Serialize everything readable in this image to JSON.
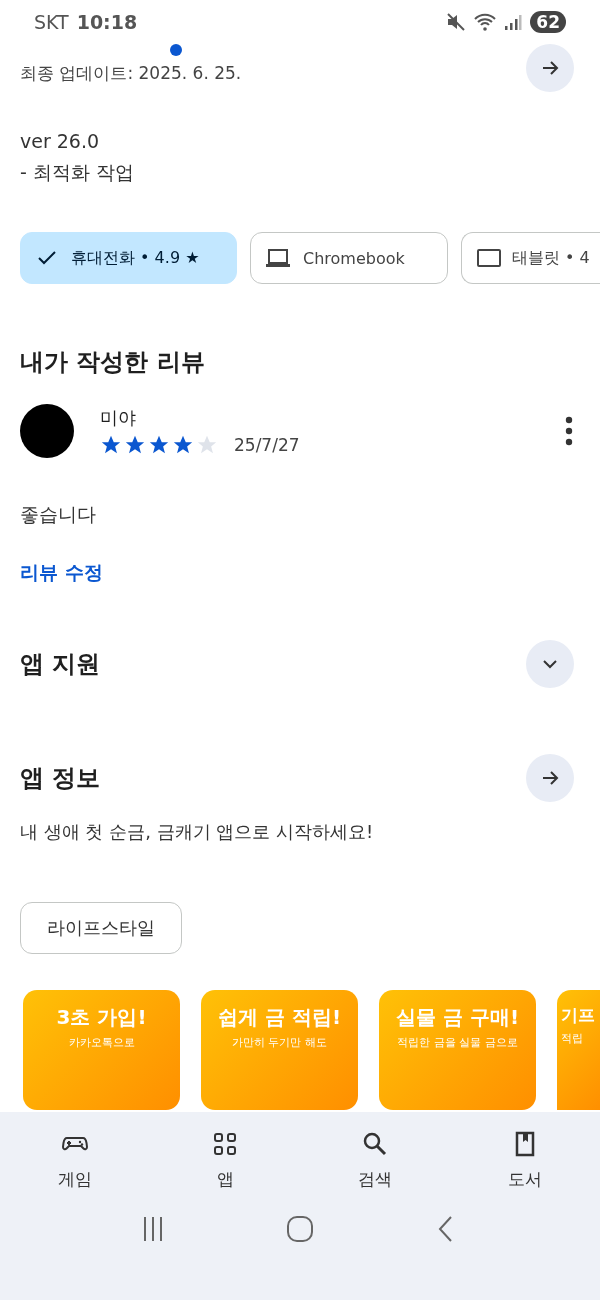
{
  "status_bar": {
    "carrier": "SKT",
    "time": "10:18",
    "battery": "62"
  },
  "whats_new": {
    "updated": "최종 업데이트: 2025. 6. 25.",
    "lines": [
      "ver 26.0",
      "- 최적화 작업"
    ]
  },
  "devices": [
    {
      "kind": "phone",
      "label": "휴대전화 • 4.9 ★",
      "selected": true
    },
    {
      "kind": "laptop",
      "label": "Chromebook",
      "selected": false
    },
    {
      "kind": "tablet",
      "label": "태블릿 • 4",
      "selected": false
    }
  ],
  "my_review": {
    "title": "내가 작성한 리뷰",
    "author": "미야",
    "stars": 4,
    "date": "25/7/27",
    "text": "좋습니다",
    "edit_link": "리뷰 수정"
  },
  "app_support": {
    "title": "앱 지원",
    "expanded": false
  },
  "app_info": {
    "title": "앱 정보",
    "description": "내 생애 첫 순금, 금캐기 앱으로 시작하세요!",
    "category": "라이프스타일"
  },
  "screenshots": [
    {
      "title": "3초 가입!",
      "subtitle": "카카오톡으로"
    },
    {
      "title": "쉽게 금 적립!",
      "subtitle": "가만히 두기만 해도"
    },
    {
      "title": "실물 금 구매!",
      "subtitle": "적립한 금을 실물 금으로"
    },
    {
      "title": "기프",
      "subtitle": "적립"
    }
  ],
  "bottom_nav": [
    {
      "kind": "games",
      "label": "게임",
      "selected": false
    },
    {
      "kind": "apps",
      "label": "앱",
      "selected": false
    },
    {
      "kind": "search",
      "label": "검색",
      "selected": false
    },
    {
      "kind": "books",
      "label": "도서",
      "selected": false
    }
  ]
}
